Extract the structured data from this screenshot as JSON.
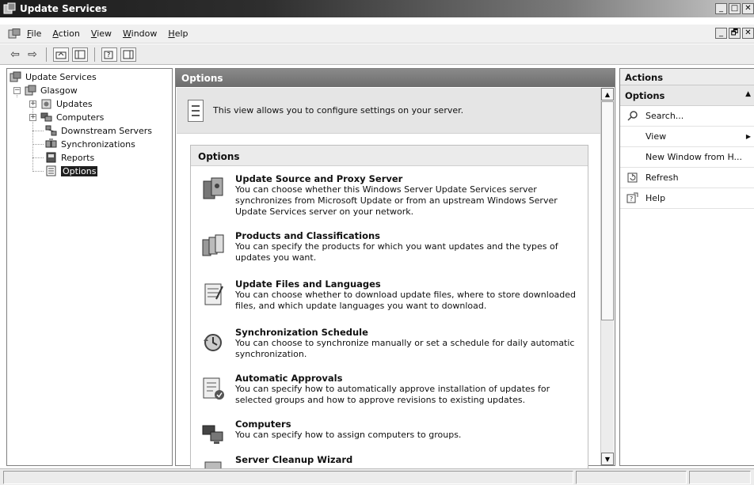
{
  "window": {
    "title": "Update Services",
    "buttons": [
      "_",
      "□",
      "✕"
    ],
    "mdi_buttons": [
      "_",
      "🗗",
      "✕"
    ]
  },
  "menu": [
    "File",
    "Action",
    "View",
    "Window",
    "Help"
  ],
  "toolbar": {
    "back_icon": "back-arrow-icon",
    "forward_icon": "forward-arrow-icon"
  },
  "tree": {
    "root": "Update Services",
    "server": "Glasgow",
    "items": [
      "Updates",
      "Computers",
      "Downstream Servers",
      "Synchronizations",
      "Reports",
      "Options"
    ],
    "selected": "Options"
  },
  "center": {
    "header": "Options",
    "intro": "This view allows you to configure settings on your server.",
    "box_title": "Options",
    "options": [
      {
        "title": "Update Source and Proxy Server",
        "desc": "You can choose whether this Windows Server Update Services server synchronizes from Microsoft Update or from an upstream Windows Server Update Services server on your network."
      },
      {
        "title": "Products and Classifications",
        "desc": "You can specify the products for which you want updates and the types of updates you want."
      },
      {
        "title": "Update Files and Languages",
        "desc": "You can choose whether to download update files, where to store downloaded files, and which update languages you want to download."
      },
      {
        "title": "Synchronization Schedule",
        "desc": "You can choose to synchronize manually or set a schedule for daily automatic synchronization."
      },
      {
        "title": "Automatic Approvals",
        "desc": "You can specify how to automatically approve installation of updates for selected groups and how to approve revisions to existing updates."
      },
      {
        "title": "Computers",
        "desc": "You can specify how to assign computers to groups."
      },
      {
        "title": "Server Cleanup Wizard",
        "desc": ""
      }
    ]
  },
  "actions": {
    "header": "Actions",
    "section": "Options",
    "items": [
      "Search...",
      "View",
      "New Window from H...",
      "Refresh",
      "Help"
    ]
  },
  "colors": {
    "title_dark": "#1c1c1c",
    "pane_header": "#6d6d6d",
    "selection": "#1f1f1f"
  }
}
